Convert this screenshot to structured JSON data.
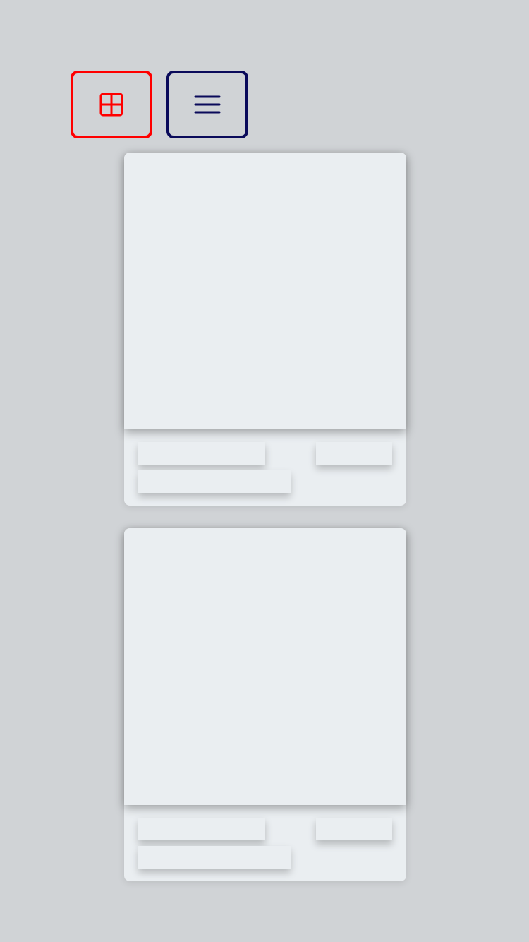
{
  "toolbar": {
    "grid_view": {
      "icon": "grid-icon",
      "color": "#ff0000",
      "active": true
    },
    "list_view": {
      "icon": "menu-icon",
      "color": "#0a0a5a",
      "active": false
    }
  },
  "colors": {
    "background": "#d0d3d6",
    "card": "#eaeef1"
  },
  "cards": [
    {
      "state": "loading"
    },
    {
      "state": "loading"
    }
  ]
}
